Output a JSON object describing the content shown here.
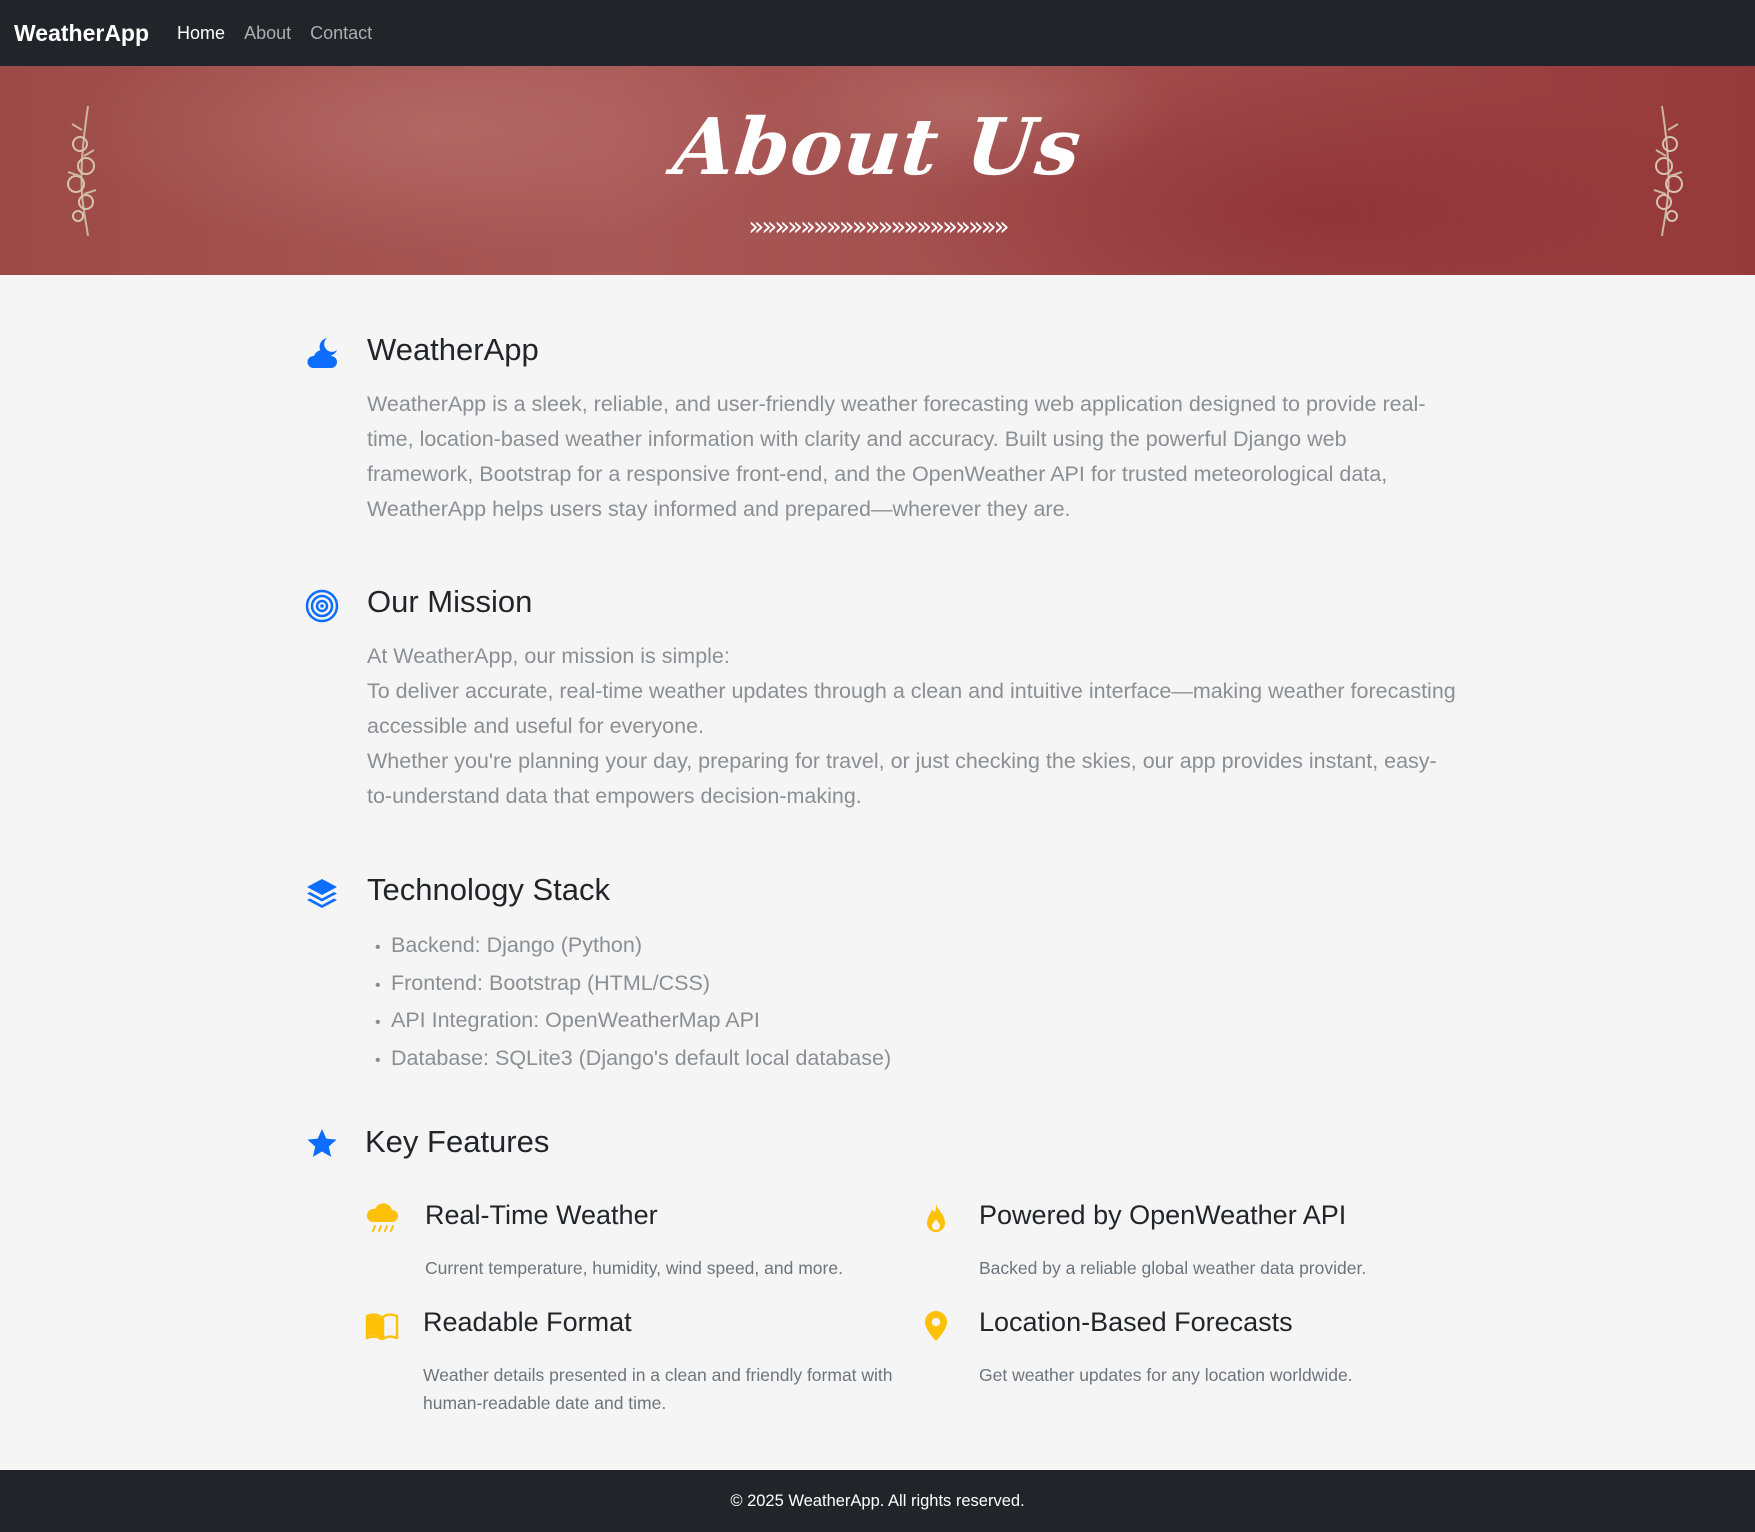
{
  "navbar": {
    "brand": "WeatherApp",
    "links": [
      {
        "label": "Home",
        "active": true
      },
      {
        "label": "About",
        "active": false
      },
      {
        "label": "Contact",
        "active": false
      }
    ]
  },
  "hero": {
    "title": "About Us",
    "arrows": "»»»»»»»»»»»»»»»»»»»»"
  },
  "sections": {
    "app": {
      "title": "WeatherApp",
      "icon": "cloud-moon-icon",
      "text": "WeatherApp is a sleek, reliable, and user-friendly weather forecasting web application designed to provide real-time, location-based weather information with clarity and accuracy. Built using the powerful Django web framework, Bootstrap for a responsive front-end, and the OpenWeather API for trusted meteorological data, WeatherApp helps users stay informed and prepared—wherever they are."
    },
    "mission": {
      "title": "Our Mission",
      "icon": "target-icon",
      "line1": "At WeatherApp, our mission is simple:",
      "line2": "To deliver accurate, real-time weather updates through a clean and intuitive interface—making weather forecasting accessible and useful for everyone.",
      "line3": "Whether you're planning your day, preparing for travel, or just checking the skies, our app provides instant, easy-to-understand data that empowers decision-making."
    },
    "stack": {
      "title": "Technology Stack",
      "icon": "layers-icon",
      "items": [
        "Backend: Django (Python)",
        "Frontend: Bootstrap (HTML/CSS)",
        "API Integration: OpenWeatherMap API",
        "Database: SQLite3 (Django's default local database)"
      ]
    },
    "features": {
      "title": "Key Features",
      "icon": "star-icon",
      "items": [
        {
          "title": "Real-Time Weather",
          "desc": "Current temperature, humidity, wind speed, and more.",
          "icon": "cloud-rain-icon"
        },
        {
          "title": "Powered by OpenWeather API",
          "desc": "Backed by a reliable global weather data provider.",
          "icon": "fire-icon"
        },
        {
          "title": "Readable Format",
          "desc": "Weather details presented in a clean and friendly format with human-readable date and time.",
          "icon": "book-icon"
        },
        {
          "title": "Location-Based Forecasts",
          "desc": "Get weather updates for any location worldwide.",
          "icon": "location-pin-icon"
        }
      ]
    }
  },
  "footer": {
    "text": "© 2025 WeatherApp. All rights reserved."
  },
  "colors": {
    "navbar": "#212529",
    "accent_blue": "#0d6efd",
    "accent_yellow": "#ffc107",
    "hero_red": "#a04a4a"
  }
}
